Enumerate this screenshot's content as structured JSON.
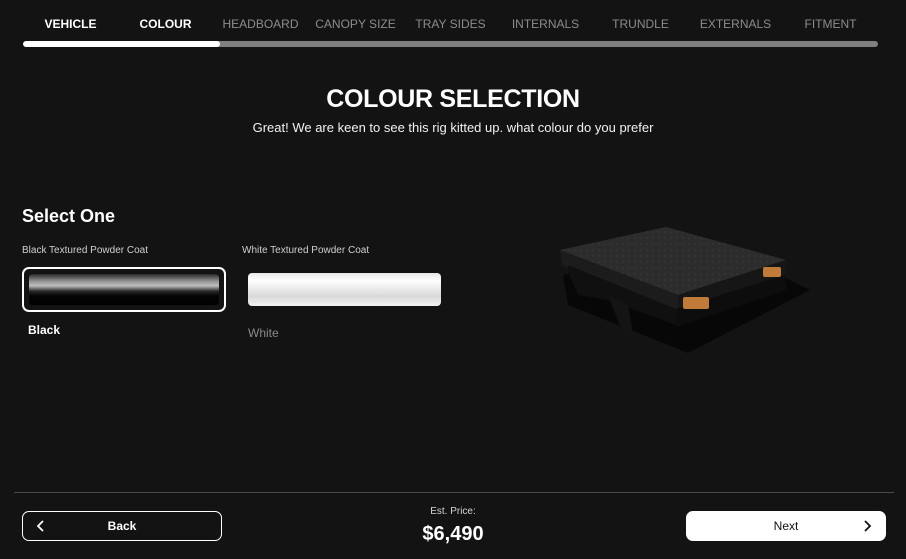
{
  "steps": [
    {
      "label": "VEHICLE",
      "state": "done"
    },
    {
      "label": "COLOUR",
      "state": "active"
    },
    {
      "label": "HEADBOARD",
      "state": "pending"
    },
    {
      "label": "CANOPY SIZE",
      "state": "pending"
    },
    {
      "label": "TRAY SIDES",
      "state": "pending"
    },
    {
      "label": "INTERNALS",
      "state": "pending"
    },
    {
      "label": "TRUNDLE",
      "state": "pending"
    },
    {
      "label": "EXTERNALS",
      "state": "pending"
    },
    {
      "label": "FITMENT",
      "state": "pending"
    }
  ],
  "progress": {
    "completed_fraction": 0.23
  },
  "header": {
    "title": "COLOUR SELECTION",
    "subtitle": "Great! We are keen to see this rig kitted up. what colour do you prefer"
  },
  "selection": {
    "heading": "Select One",
    "options": [
      {
        "name": "Black Textured Powder Coat",
        "label": "Black",
        "selected": true
      },
      {
        "name": "White Textured Powder Coat",
        "label": "White",
        "selected": false
      }
    ]
  },
  "footer": {
    "back_label": "Back",
    "next_label": "Next",
    "price_label": "Est. Price:",
    "price_value": "$6,490"
  },
  "icons": {
    "back": "chevron-left-icon",
    "next": "chevron-right-icon"
  },
  "colors": {
    "background": "#131313",
    "text": "#ffffff",
    "muted_text": "#8c8c8c",
    "progress_track": "#7f7f7f",
    "progress_fill": "#ffffff",
    "accent": "#c07a3a"
  }
}
